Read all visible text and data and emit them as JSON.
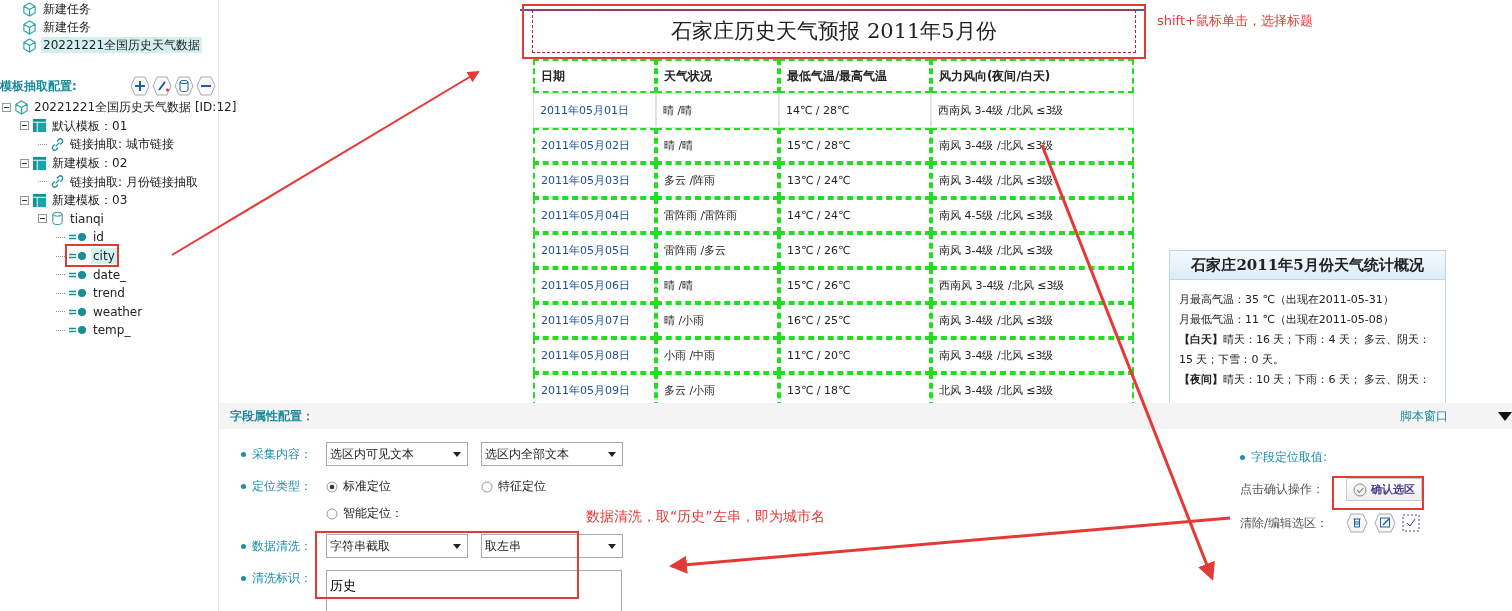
{
  "task_tree": [
    {
      "label": "新建任务",
      "selected": false
    },
    {
      "label": "新建任务",
      "selected": false
    },
    {
      "label": "20221221全国历史天气数据",
      "selected": true
    }
  ],
  "template_config": {
    "title": "模板抽取配置:"
  },
  "template_tree": [
    {
      "label": "20221221全国历史天气数据 [ID:12]",
      "kind": "task",
      "expanded": true,
      "selected": false,
      "children": [
        {
          "label": "默认模板：01",
          "kind": "template",
          "expanded": true,
          "selected": false,
          "children": [
            {
              "label": "链接抽取: 城市链接",
              "kind": "link",
              "selected": false
            }
          ]
        },
        {
          "label": "新建模板：02",
          "kind": "template",
          "expanded": true,
          "selected": false,
          "children": [
            {
              "label": "链接抽取: 月份链接抽取",
              "kind": "link",
              "selected": false
            }
          ]
        },
        {
          "label": "新建模板：03",
          "kind": "template",
          "expanded": true,
          "selected": false,
          "children": [
            {
              "label": "tianqi",
              "kind": "table",
              "expanded": true,
              "selected": false,
              "children": [
                {
                  "label": "id",
                  "kind": "field",
                  "selected": false
                },
                {
                  "label": "city",
                  "kind": "field",
                  "selected": true
                },
                {
                  "label": "date_",
                  "kind": "field",
                  "selected": false
                },
                {
                  "label": "trend",
                  "kind": "field",
                  "selected": false
                },
                {
                  "label": "weather",
                  "kind": "field",
                  "selected": false
                },
                {
                  "label": "temp_",
                  "kind": "field",
                  "selected": false
                }
              ]
            }
          ]
        }
      ]
    }
  ],
  "page": {
    "title": "石家庄历史天气预报  2011年5月份",
    "table": {
      "columns": [
        "日期",
        "天气状况",
        "最低气温/最高气温",
        "风力风向(夜间/白天)"
      ],
      "rows": [
        {
          "highlighted": false,
          "cells": [
            "2011年05月01日",
            "晴  /晴",
            "14℃  /  28℃",
            "西南风  3-4级  /北风  ≤3级"
          ]
        },
        {
          "highlighted": true,
          "cells": [
            "2011年05月02日",
            "晴  /晴",
            "15℃  /  28℃",
            "南风  3-4级  /北风  ≤3级"
          ]
        },
        {
          "highlighted": true,
          "cells": [
            "2011年05月03日",
            "多云  /阵雨",
            "13℃  /  24℃",
            "南风  3-4级  /北风  ≤3级"
          ]
        },
        {
          "highlighted": true,
          "cells": [
            "2011年05月04日",
            "雷阵雨  /雷阵雨",
            "14℃  /  24℃",
            "南风  4-5级  /北风  ≤3级"
          ]
        },
        {
          "highlighted": true,
          "cells": [
            "2011年05月05日",
            "雷阵雨  /多云",
            "13℃  /  26℃",
            "南风  3-4级  /北风  ≤3级"
          ]
        },
        {
          "highlighted": true,
          "cells": [
            "2011年05月06日",
            "晴  /晴",
            "15℃  /  26℃",
            "西南风  3-4级  /北风  ≤3级"
          ]
        },
        {
          "highlighted": true,
          "cells": [
            "2011年05月07日",
            "晴  /小雨",
            "16℃  /  25℃",
            "南风  3-4级  /北风  ≤3级"
          ]
        },
        {
          "highlighted": true,
          "cells": [
            "2011年05月08日",
            "小雨  /中雨",
            "11℃  /  20℃",
            "南风  3-4级  /北风  ≤3级"
          ]
        },
        {
          "highlighted": true,
          "cells": [
            "2011年05月09日",
            "多云  /小雨",
            "13℃  /  18℃",
            "北风  3-4级  /北风  ≤3级"
          ]
        }
      ]
    },
    "stats": {
      "title": "石家庄2011年5月份天气统计概况",
      "lines": [
        "月最高气温：35 ℃（出现在2011-05-31）",
        "月最低气温：11 ℃（出现在2011-05-08）",
        "**【白天】**晴天：16 天；下雨：4 天；  多云、阴天：15 天；下雪：0 天。",
        "**【夜间】**晴天：10 天；下雨：6 天；  多云、阴天："
      ]
    }
  },
  "field_config": {
    "title": "字段属性配置：",
    "script_link": "脚本窗口",
    "collect": {
      "label": "采集内容：",
      "selects": [
        "选区内可见文本",
        "选区内全部文本"
      ]
    },
    "positioning": {
      "label": "定位类型：",
      "options": [
        {
          "label": "标准定位",
          "selected": true
        },
        {
          "label": "特征定位",
          "selected": false
        },
        {
          "label": "智能定位：",
          "selected": false
        }
      ]
    },
    "cleaning": {
      "label": "数据清洗：",
      "selects": [
        "字符串截取",
        "取左串"
      ]
    },
    "clean_mark": {
      "label": "清洗标识：",
      "value": "历史"
    },
    "locate": {
      "title": "字段定位取值:",
      "confirm_label": "点击确认操作：",
      "confirm_button": "确认选区",
      "edit_label": "清除/编辑选区："
    }
  },
  "annotations": [
    "shift+鼠标单击，选择标题",
    "数据清洗，取“历史”左串，即为城市名"
  ]
}
